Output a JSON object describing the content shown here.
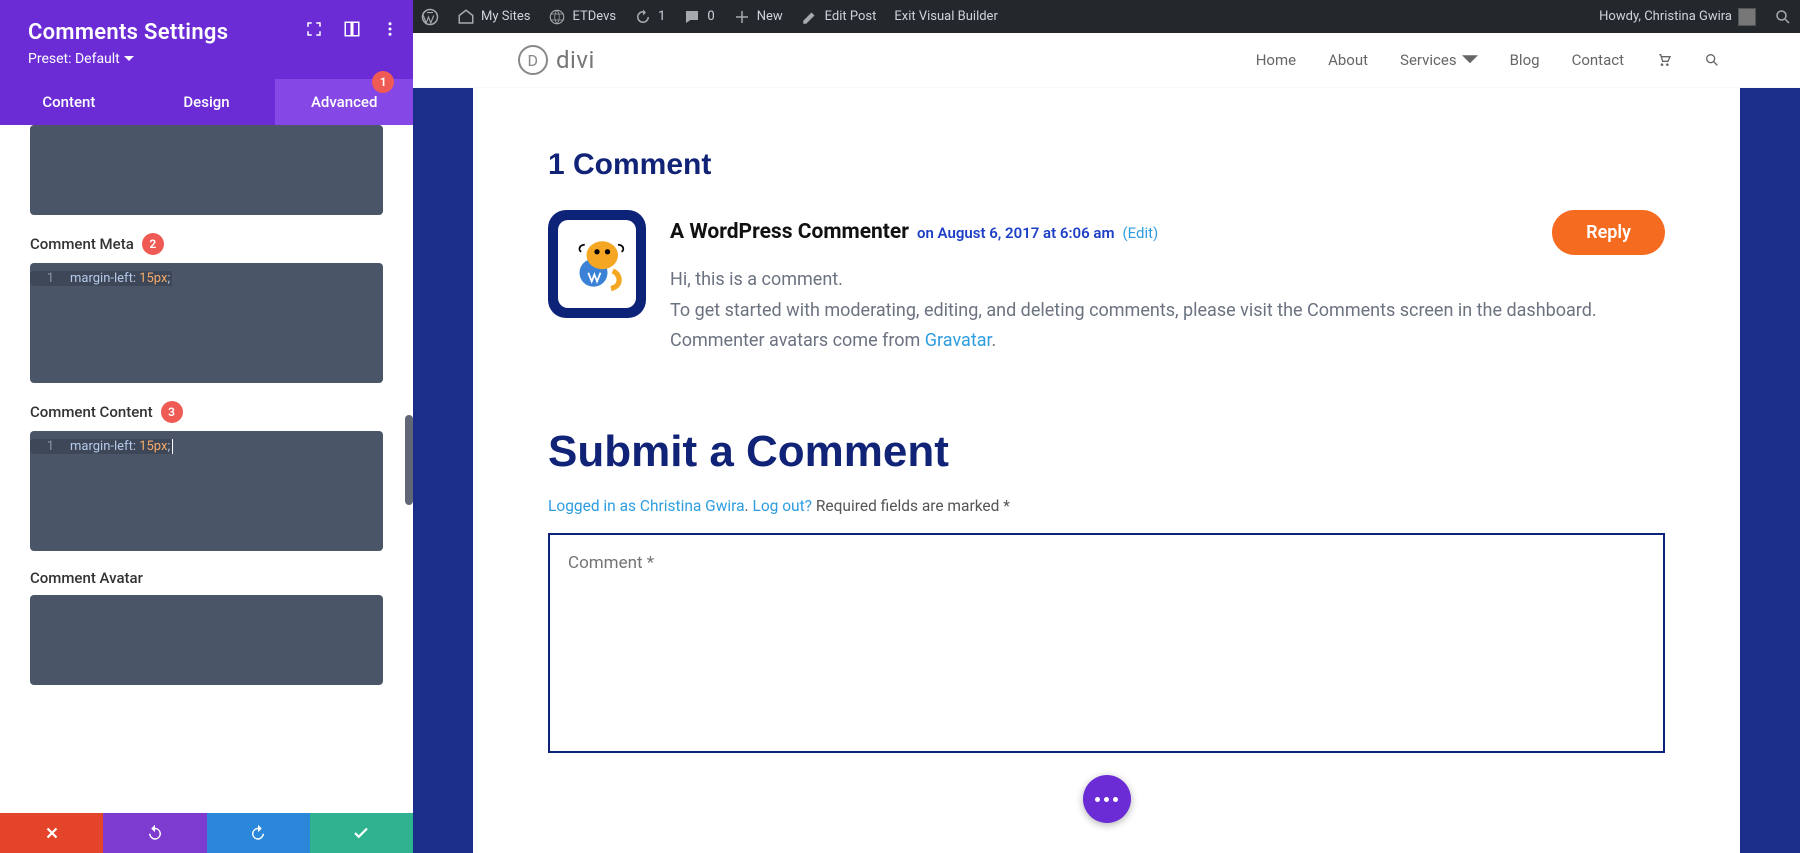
{
  "sidebar": {
    "title": "Comments Settings",
    "preset": "Preset: Default",
    "tabs": {
      "content": "Content",
      "design": "Design",
      "advanced": "Advanced",
      "advanced_badge": "1"
    },
    "fields": {
      "comment_meta": {
        "label": "Comment Meta",
        "badge": "2",
        "code": {
          "line_num": "1",
          "prop": "margin-left:",
          "val": " 15px",
          "punc": ";"
        }
      },
      "comment_content": {
        "label": "Comment Content",
        "badge": "3",
        "code": {
          "line_num": "1",
          "prop": "margin-left:",
          "val": " 15px",
          "punc": ";"
        }
      },
      "comment_avatar": {
        "label": "Comment Avatar"
      }
    }
  },
  "wpbar": {
    "mysites": "My Sites",
    "etdevs": "ETDevs",
    "refresh": "1",
    "comments": "0",
    "new": "New",
    "edit": "Edit Post",
    "exit": "Exit Visual Builder",
    "howdy": "Howdy, Christina Gwira"
  },
  "header": {
    "logo": "divi",
    "nav": {
      "home": "Home",
      "about": "About",
      "services": "Services",
      "blog": "Blog",
      "contact": "Contact"
    }
  },
  "page": {
    "comments_heading": "1 Comment",
    "comment": {
      "author": "A WordPress Commenter",
      "meta": "on August 6, 2017 at 6:06 am",
      "edit": "(Edit)",
      "reply": "Reply",
      "line1": "Hi, this is a comment.",
      "line2": "To get started with moderating, editing, and deleting comments, please visit the Comments screen in the dashboard.",
      "line3a": "Commenter avatars come from ",
      "line3b": "Gravatar",
      "line3c": "."
    },
    "submit_heading": "Submit a Comment",
    "login": {
      "as": "Logged in as Christina Gwira",
      "dot": ". ",
      "out": "Log out?",
      "req": " Required fields are marked *"
    },
    "placeholder": "Comment *"
  }
}
